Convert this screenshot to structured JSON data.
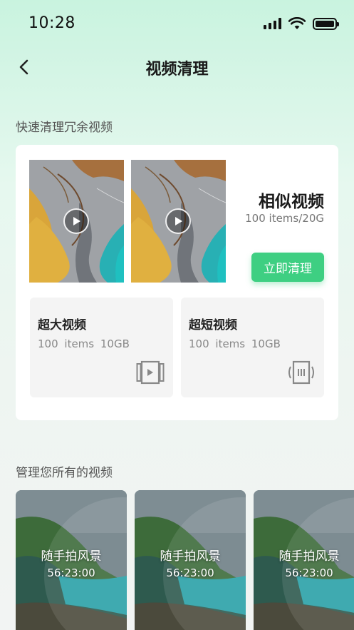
{
  "status_bar": {
    "time": "10:28",
    "icons": [
      "signal-icon",
      "wifi-icon",
      "battery-icon"
    ]
  },
  "nav": {
    "title": "视频清理",
    "back_icon": "chevron-left-icon"
  },
  "quick_clean": {
    "section_label": "快速清理冗余视频",
    "similar": {
      "title": "相似视频",
      "meta": "100 items/20G",
      "button_label": "立即清理"
    },
    "categories": [
      {
        "title": "超大视频",
        "meta": "100 items  10GB",
        "icon": "large-video-icon"
      },
      {
        "title": "超短视频",
        "meta": "100 items  10GB",
        "icon": "short-video-icon"
      }
    ]
  },
  "manage": {
    "section_label": "管理您所有的视频",
    "videos": [
      {
        "name": "随手拍风景",
        "duration": "56:23:00"
      },
      {
        "name": "随手拍风景",
        "duration": "56:23:00"
      },
      {
        "name": "随手拍风景",
        "duration": "56:23:00"
      }
    ]
  },
  "colors": {
    "accent": "#3ecf82",
    "background_top": "#c9f3df",
    "card": "#ffffff",
    "sub_card": "#f4f4f4"
  }
}
